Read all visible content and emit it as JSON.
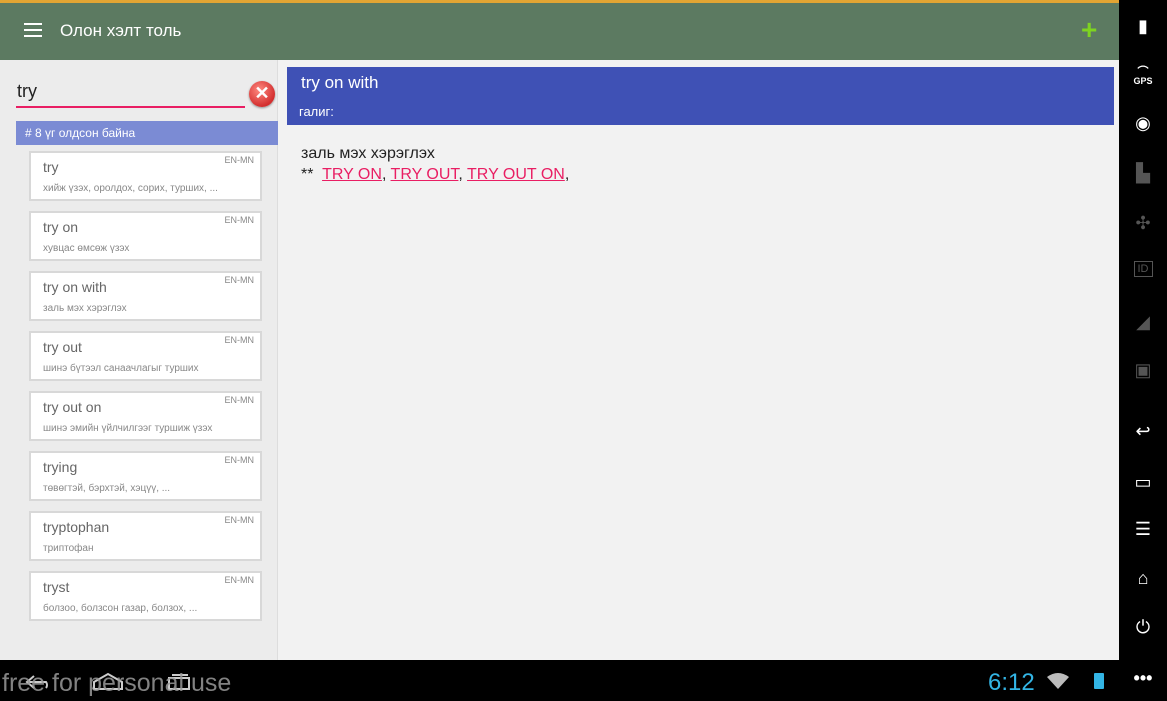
{
  "app": {
    "title": "Олон хэлт толь"
  },
  "search": {
    "value": "try",
    "cursor": "|"
  },
  "results": {
    "count_text": "# 8 үг олдсон байна",
    "items": [
      {
        "word": "try",
        "lang": "EN-MN",
        "definition": "хийж үзэх,  оролдох,  сорих,  турших, ..."
      },
      {
        "word": "try on",
        "lang": "EN-MN",
        "definition": "хувцас өмсөж үзэх"
      },
      {
        "word": "try on with",
        "lang": "EN-MN",
        "definition": "заль мэх хэрэглэх"
      },
      {
        "word": "try out",
        "lang": "EN-MN",
        "definition": "шинэ бүтээл санаачлагыг турших"
      },
      {
        "word": "try out on",
        "lang": "EN-MN",
        "definition": "шинэ эмийн үйлчилгээг туршиж үзэх"
      },
      {
        "word": "trying",
        "lang": "EN-MN",
        "definition": "төвөгтэй,  бэрхтэй,  хэцүү, ..."
      },
      {
        "word": "tryptophan",
        "lang": "EN-MN",
        "definition": "триптофан"
      },
      {
        "word": "tryst",
        "lang": "EN-MN",
        "definition": "болзоо,  болзсон газар,  болзох, ..."
      }
    ]
  },
  "detail": {
    "word": "try on with",
    "galig_label": "галиг:",
    "definition": "заль мэх хэрэглэх",
    "prefix": "**",
    "links": [
      "TRY ON",
      "TRY OUT",
      "TRY OUT ON"
    ]
  },
  "statusbar": {
    "time": "6:12",
    "watermark": "free for personal use"
  },
  "sidebar": {
    "gps_label": "GPS",
    "id_label": "ID"
  },
  "colors": {
    "appbar": "#5c7a61",
    "header": "#3f51b5",
    "accent": "#e91e63",
    "clock": "#33b5e5"
  }
}
